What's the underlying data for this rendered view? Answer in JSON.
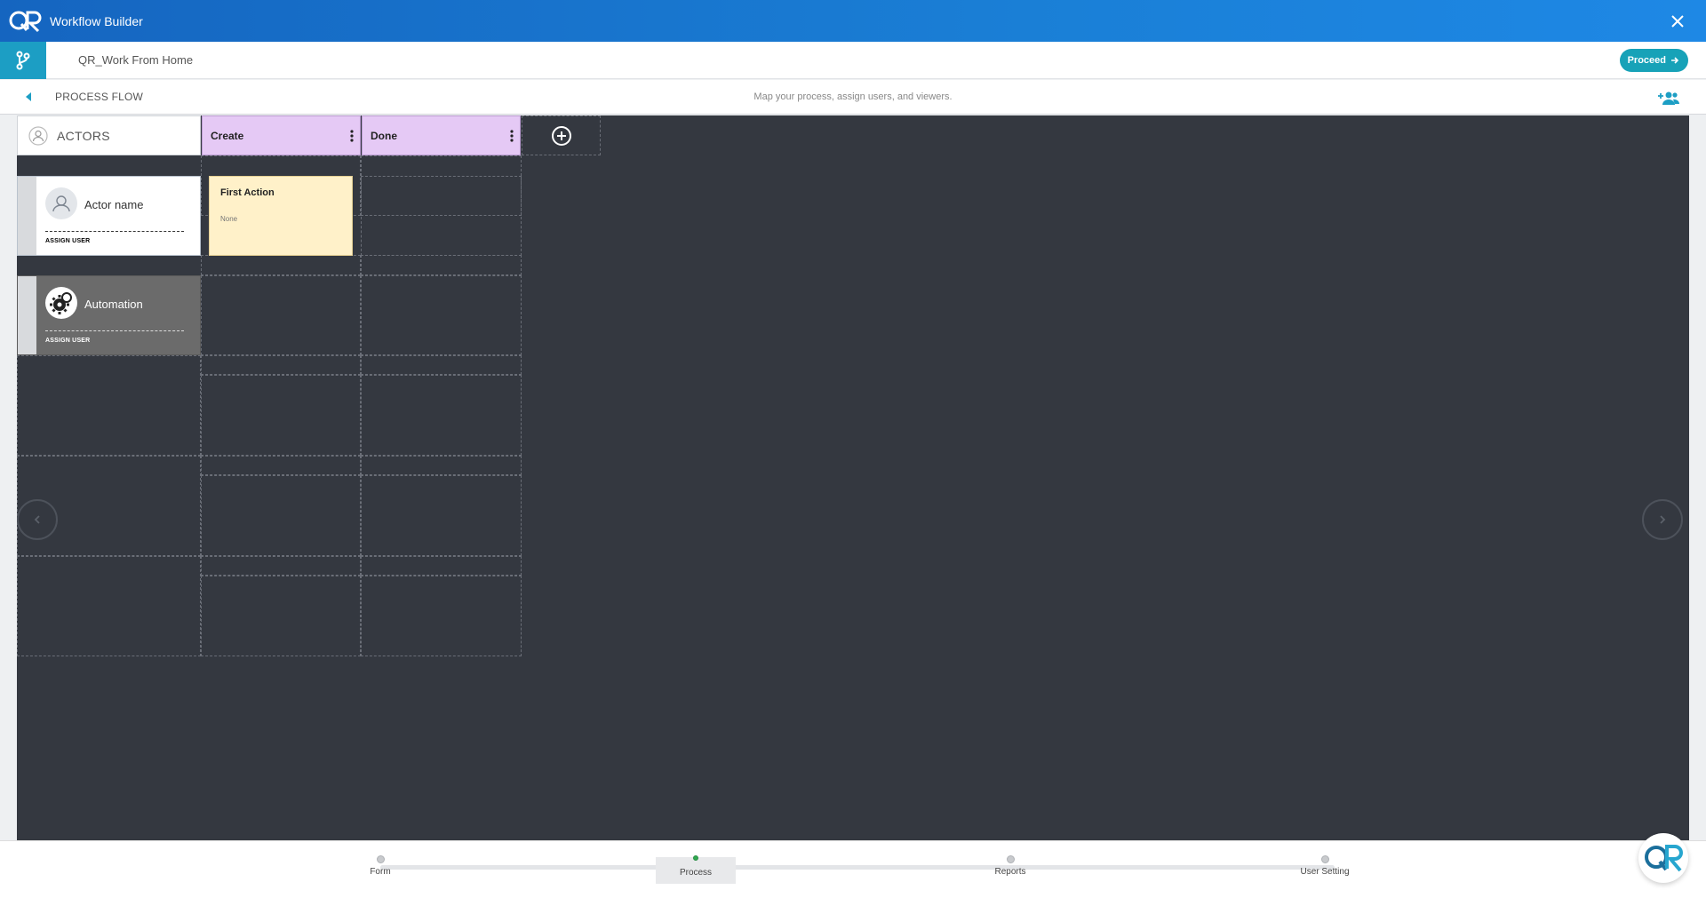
{
  "app": {
    "title": "Workflow Builder",
    "logo_text": "QR"
  },
  "subheader": {
    "workflow_name": "QR_Work From Home",
    "proceed_label": "Proceed"
  },
  "flowbar": {
    "title": "PROCESS FLOW",
    "hint": "Map your process, assign users, and viewers."
  },
  "board": {
    "actors_label": "ACTORS",
    "columns": [
      {
        "label": "Create"
      },
      {
        "label": "Done"
      }
    ],
    "actors": [
      {
        "name": "Actor name",
        "assign_label": "ASSIGN USER"
      },
      {
        "name": "Automation",
        "assign_label": "ASSIGN USER"
      }
    ],
    "action": {
      "title": "First Action",
      "description": "None"
    }
  },
  "stepper": {
    "steps": [
      {
        "label": "Form",
        "active": false
      },
      {
        "label": "Process",
        "active": true
      },
      {
        "label": "Reports",
        "active": false
      },
      {
        "label": "User Setting",
        "active": false
      }
    ]
  },
  "colors": {
    "titlebar": "#1a7fd6",
    "accent": "#17a2b8",
    "canvas": "#343840",
    "column_header": "#e5c9f5",
    "action_card": "#fff1c9",
    "active_step": "#2fa84f"
  }
}
